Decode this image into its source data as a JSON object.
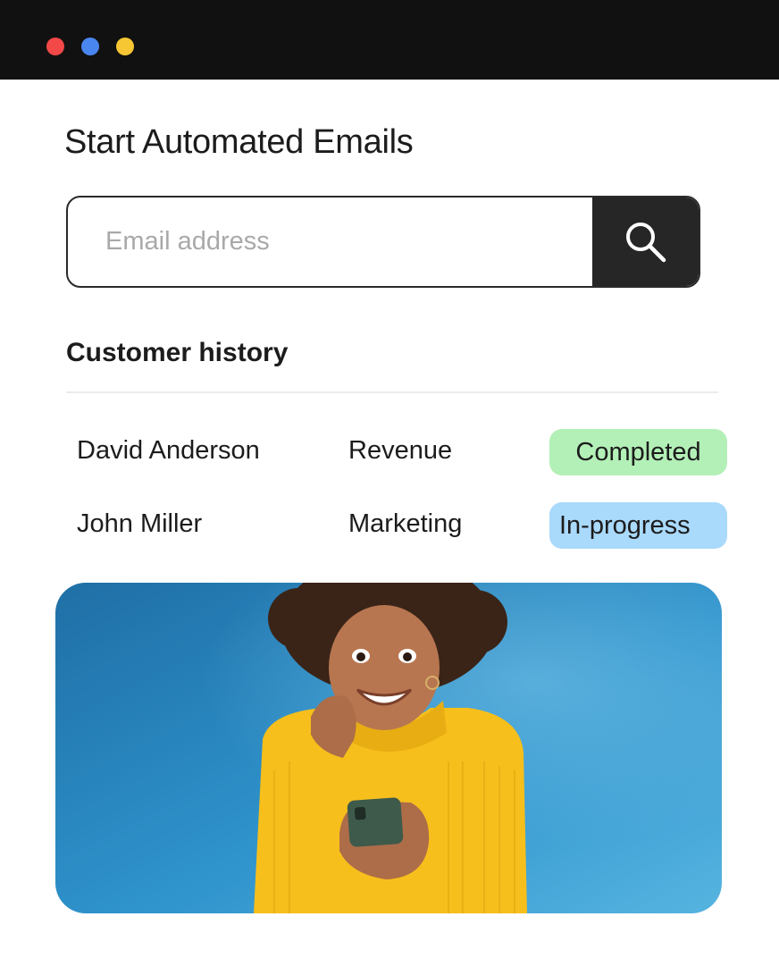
{
  "window": {
    "controls": [
      {
        "name": "close",
        "color": "#f24848"
      },
      {
        "name": "minimize",
        "color": "#4a86f0"
      },
      {
        "name": "maximize",
        "color": "#f6c633"
      }
    ]
  },
  "main": {
    "title": "Start Automated Emails",
    "search": {
      "placeholder": "Email address",
      "value": "",
      "button_icon": "search-icon"
    },
    "history": {
      "heading": "Customer history",
      "rows": [
        {
          "name": "David Anderson",
          "department": "Revenue",
          "status": "Completed",
          "status_color": "#b3f0b7"
        },
        {
          "name": "John Miller",
          "department": "Marketing",
          "status": "In-progress",
          "status_color": "#a9d9fb"
        }
      ]
    },
    "photo": {
      "subject": "woman-in-yellow-sweater-holding-phone",
      "background_color": "#2f8fc7",
      "sweater_color": "#f7c21a"
    }
  }
}
